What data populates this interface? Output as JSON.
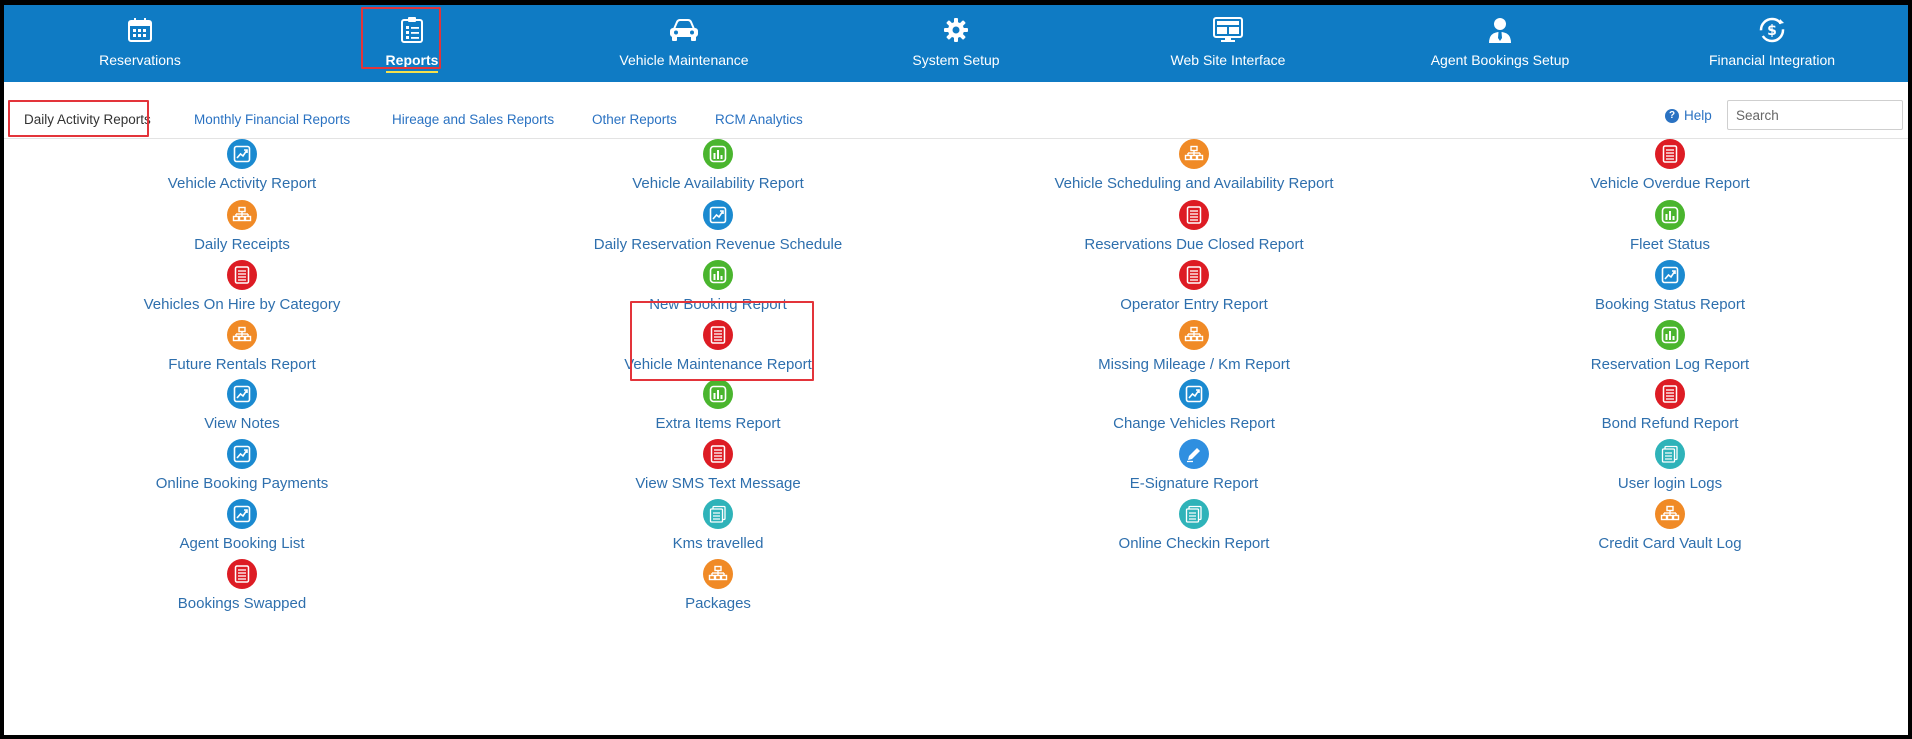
{
  "nav": {
    "items": [
      {
        "id": "reservations",
        "label": "Reservations",
        "icon": "calendar-icon"
      },
      {
        "id": "reports",
        "label": "Reports",
        "icon": "clipboard-list-icon",
        "active": true
      },
      {
        "id": "vehicle-maintenance",
        "label": "Vehicle Maintenance",
        "icon": "car-icon"
      },
      {
        "id": "system-setup",
        "label": "System Setup",
        "icon": "gear-icon"
      },
      {
        "id": "web-site-interface",
        "label": "Web Site Interface",
        "icon": "monitor-icon"
      },
      {
        "id": "agent-bookings-setup",
        "label": "Agent Bookings Setup",
        "icon": "user-tie-icon"
      },
      {
        "id": "financial-integration",
        "label": "Financial Integration",
        "icon": "dollar-sync-icon"
      }
    ]
  },
  "subnav": {
    "tabs": [
      {
        "label": "Daily Activity Reports",
        "active": true
      },
      {
        "label": "Monthly Financial Reports"
      },
      {
        "label": "Hireage and Sales Reports"
      },
      {
        "label": "Other Reports"
      },
      {
        "label": "RCM Analytics"
      }
    ],
    "help_label": "Help",
    "search_placeholder": "Search"
  },
  "colors": {
    "header_bg": "#0f7bc4",
    "link": "#2e6fad",
    "highlight_box": "#e3343a",
    "active_underline": "#f4e04d",
    "icon_blue": "#1b8ad0",
    "icon_green": "#4ab52e",
    "icon_orange": "#f08a26",
    "icon_red": "#dd1c24",
    "icon_teal": "#2fb3b9"
  },
  "reports": {
    "columns": [
      [
        {
          "label": "Vehicle Activity Report",
          "icon": "trend-chart-icon",
          "color": "blue"
        },
        {
          "label": "Daily Receipts",
          "icon": "hierarchy-icon",
          "color": "orange"
        },
        {
          "label": "Vehicles On Hire by Category",
          "icon": "document-icon",
          "color": "red"
        },
        {
          "label": "Future Rentals Report",
          "icon": "hierarchy-icon",
          "color": "orange"
        },
        {
          "label": "View Notes",
          "icon": "trend-chart-icon",
          "color": "blue"
        },
        {
          "label": "Online Booking Payments",
          "icon": "trend-chart-icon",
          "color": "blue"
        },
        {
          "label": "Agent Booking List",
          "icon": "trend-chart-icon",
          "color": "blue"
        },
        {
          "label": "Bookings Swapped",
          "icon": "document-icon",
          "color": "red"
        }
      ],
      [
        {
          "label": "Vehicle Availability Report",
          "icon": "bar-chart-icon",
          "color": "green"
        },
        {
          "label": "Daily Reservation Revenue Schedule",
          "icon": "trend-chart-icon",
          "color": "blue"
        },
        {
          "label": "New Booking Report",
          "icon": "bar-chart-icon",
          "color": "green",
          "highlight": true
        },
        {
          "label": "Vehicle Maintenance Report",
          "icon": "document-icon",
          "color": "red"
        },
        {
          "label": "Extra Items Report",
          "icon": "bar-chart-icon",
          "color": "green"
        },
        {
          "label": "View SMS Text Message",
          "icon": "document-icon",
          "color": "red"
        },
        {
          "label": "Kms travelled",
          "icon": "stacked-docs-icon",
          "color": "teal"
        },
        {
          "label": "Packages",
          "icon": "hierarchy-icon",
          "color": "orange"
        }
      ],
      [
        {
          "label": "Vehicle Scheduling and Availability Report",
          "icon": "hierarchy-icon",
          "color": "orange"
        },
        {
          "label": "Reservations Due Closed Report",
          "icon": "document-icon",
          "color": "red"
        },
        {
          "label": "Operator Entry Report",
          "icon": "document-icon",
          "color": "red"
        },
        {
          "label": "Missing Mileage / Km Report",
          "icon": "hierarchy-icon",
          "color": "orange"
        },
        {
          "label": "Change Vehicles Report",
          "icon": "trend-chart-icon",
          "color": "blue"
        },
        {
          "label": "E-Signature Report",
          "icon": "pen-icon",
          "color": "lblue"
        },
        {
          "label": "Online Checkin Report",
          "icon": "stacked-docs-icon",
          "color": "teal"
        }
      ],
      [
        {
          "label": "Vehicle Overdue Report",
          "icon": "document-icon",
          "color": "red"
        },
        {
          "label": "Fleet Status",
          "icon": "bar-chart-icon",
          "color": "green"
        },
        {
          "label": "Booking Status Report",
          "icon": "trend-chart-icon",
          "color": "blue"
        },
        {
          "label": "Reservation Log Report",
          "icon": "bar-chart-icon",
          "color": "green"
        },
        {
          "label": "Bond Refund Report",
          "icon": "document-icon",
          "color": "red"
        },
        {
          "label": "User login Logs",
          "icon": "stacked-docs-icon",
          "color": "teal"
        },
        {
          "label": "Credit Card Vault Log",
          "icon": "hierarchy-icon",
          "color": "orange"
        }
      ]
    ]
  }
}
